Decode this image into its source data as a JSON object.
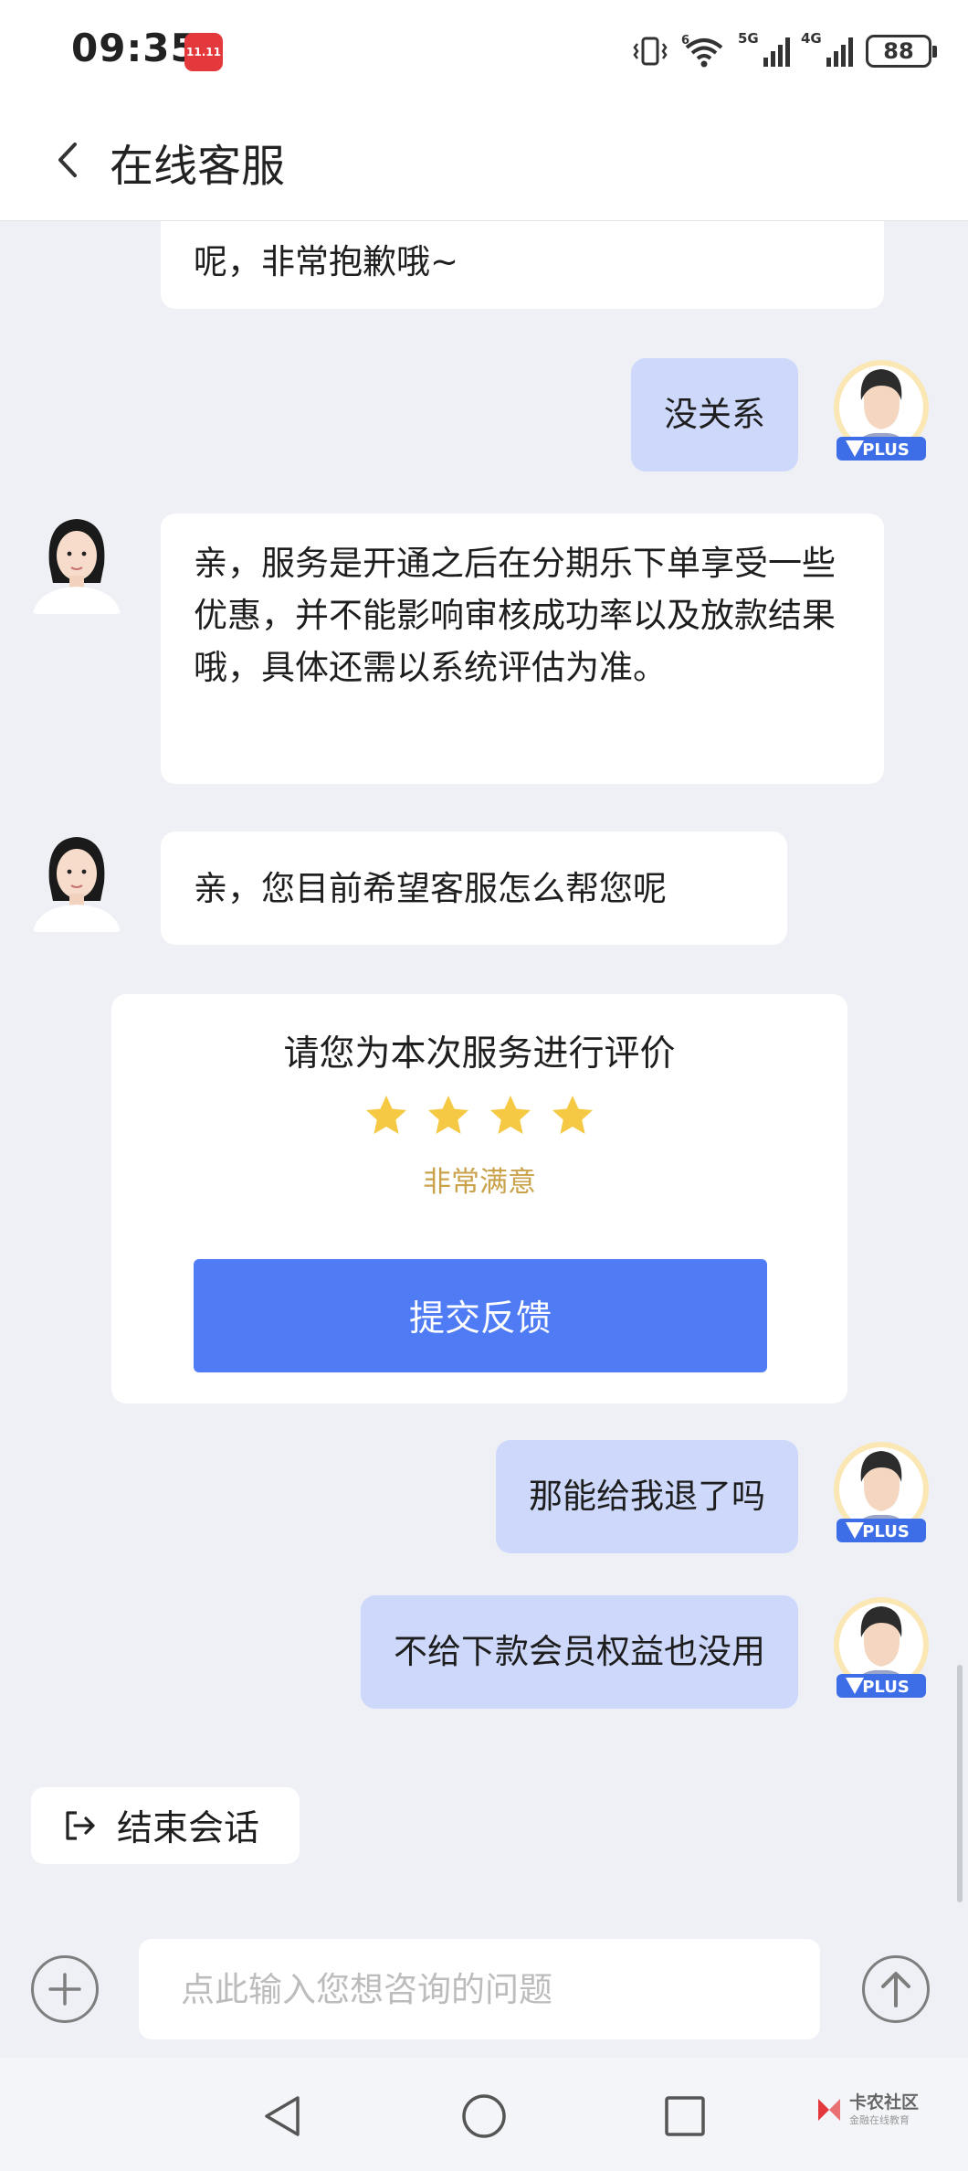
{
  "status_bar": {
    "time": "09:35",
    "app_icon_label": "11.11",
    "signal_5g_label": "5G",
    "signal_4g_label": "4G",
    "wifi_label": "6",
    "battery": "88"
  },
  "header": {
    "title": "在线客服"
  },
  "messages": [
    {
      "role": "agent",
      "text": "呢，非常抱歉哦~"
    },
    {
      "role": "user",
      "text": "没关系"
    },
    {
      "role": "agent",
      "text": "亲，服务是开通之后在分期乐下单享受一些优惠，并不能影响审核成功率以及放款结果哦，具体还需以系统评估为准。"
    },
    {
      "role": "agent",
      "text": "亲，您目前希望客服怎么帮您呢"
    },
    {
      "role": "user",
      "text": "那能给我退了吗"
    },
    {
      "role": "user",
      "text": "不给下款会员权益也没用"
    }
  ],
  "user_badge": "PLUS",
  "rating": {
    "title": "请您为本次服务进行评价",
    "stars_filled": 4,
    "level_text": "非常满意",
    "submit_label": "提交反馈",
    "star_color": "#f5c944"
  },
  "end_session_label": "结束会话",
  "input": {
    "placeholder": "点此输入您想咨询的问题"
  },
  "watermark": {
    "main": "卡农社区",
    "sub": "金融在线教育"
  },
  "colors": {
    "accent": "#4f7bf5",
    "user_bubble": "#cdd8fb",
    "background": "#eef0f5"
  }
}
